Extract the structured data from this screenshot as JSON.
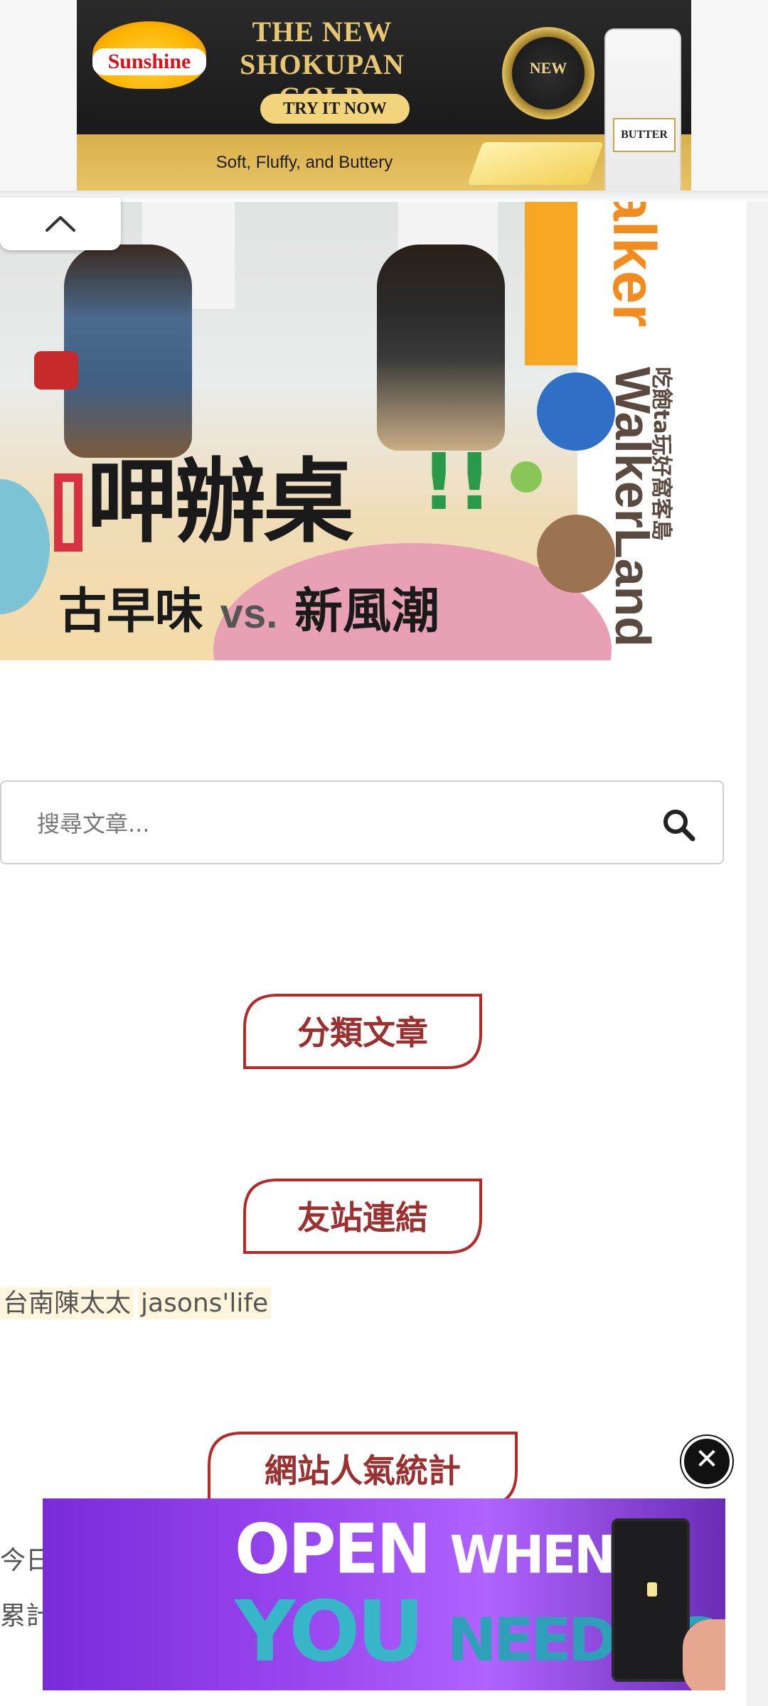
{
  "top_ad": {
    "brand": "Sunshine",
    "headline": "THE NEW SHOKUPAN GOLD",
    "cta": "TRY IT NOW",
    "tagline": "Soft, Fluffy, and Buttery",
    "seal_text": "NEW",
    "bag_label": "BUTTER",
    "icons": {
      "info": "info-icon",
      "close": "close-icon"
    }
  },
  "banner": {
    "title": "呷辦桌",
    "title_accent": "!!",
    "subtitle_left": "古早味",
    "subtitle_vs": "vs.",
    "subtitle_right": "新風潮",
    "side_brand_orange": "alker",
    "side_brand": "WalkerLand",
    "side_brand_cn": "吃飽ta玩好窩客島"
  },
  "search": {
    "placeholder": "搜尋文章..."
  },
  "sections": {
    "categories": "分類文章",
    "friend_links": "友站連結",
    "stats": "網站人氣統計"
  },
  "friend_links": [
    "台南陳太太",
    "jasons'life"
  ],
  "stats": {
    "today_prefix": "今日",
    "total_prefix": "累計"
  },
  "bottom_ad": {
    "line1_big": "OPEN",
    "line1_small": "WHEN",
    "line2_big": "YOU",
    "line2_small": "NEED US",
    "close_icon": "close-icon"
  },
  "colors": {
    "heading_border": "#b22b2b",
    "heading_text": "#9b3030",
    "ad_purple": "#9a48f0",
    "ad_teal": "#37b6c8"
  }
}
